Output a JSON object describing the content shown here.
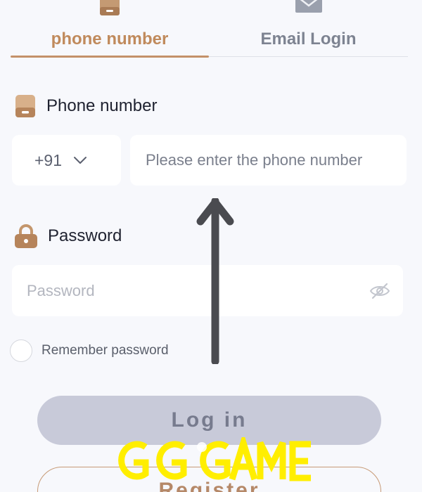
{
  "tabs": {
    "phone": {
      "label": "phone number",
      "active": true
    },
    "email": {
      "label": "Email Login",
      "active": false
    }
  },
  "phone_section": {
    "label": "Phone number",
    "country_code": "+91",
    "placeholder": "Please enter the phone number"
  },
  "password_section": {
    "label": "Password",
    "placeholder": "Password"
  },
  "remember": {
    "label": "Remember password",
    "checked": false
  },
  "buttons": {
    "login": "Log in",
    "register": "Register"
  },
  "watermark": {
    "text": "GG GAME"
  },
  "colors": {
    "accent": "#c49169",
    "tab_inactive": "#7d8391",
    "login_bg": "#c8cad9",
    "watermark": "#ffee00"
  },
  "icons": [
    "phone-icon",
    "mail-icon",
    "chevron-down-icon",
    "lock-icon",
    "eye-off-icon",
    "arrow-up-icon"
  ]
}
